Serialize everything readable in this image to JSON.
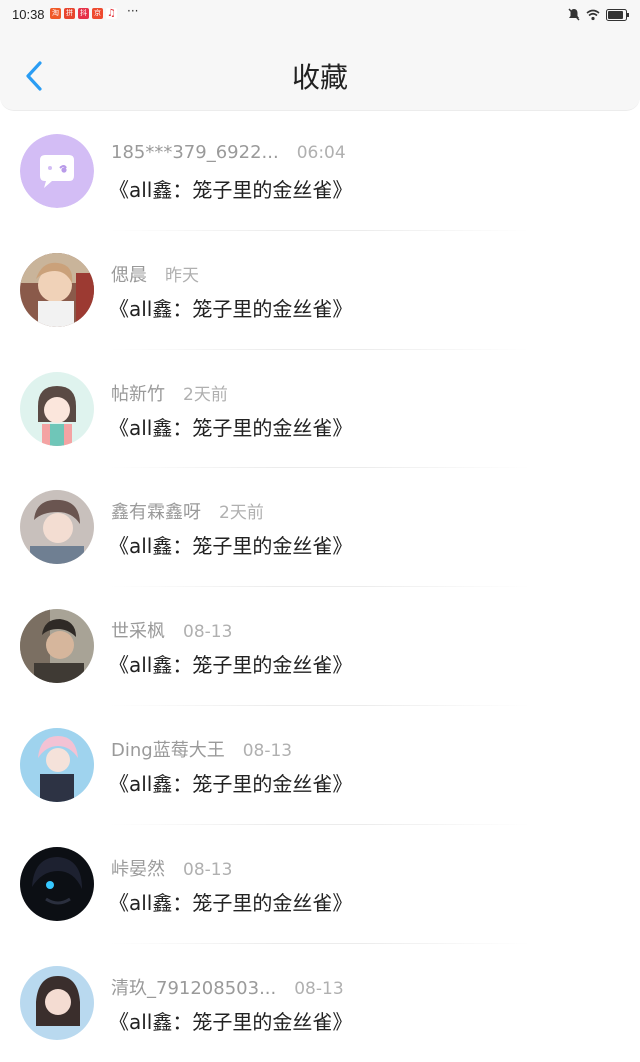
{
  "status_bar": {
    "time": "10:38",
    "dots": "···"
  },
  "header": {
    "title": "收藏"
  },
  "favorites": [
    {
      "username": "185***379_6922...",
      "time": "06:04",
      "book": "《all鑫：笼子里的金丝雀》"
    },
    {
      "username": "偲晨",
      "time": "昨天",
      "book": "《all鑫：笼子里的金丝雀》"
    },
    {
      "username": "帖新竹",
      "time": "2天前",
      "book": "《all鑫：笼子里的金丝雀》"
    },
    {
      "username": "鑫有霖鑫呀",
      "time": "2天前",
      "book": "《all鑫：笼子里的金丝雀》"
    },
    {
      "username": "世采枫",
      "time": "08-13",
      "book": "《all鑫：笼子里的金丝雀》"
    },
    {
      "username": "Ding蓝莓大王",
      "time": "08-13",
      "book": "《all鑫：笼子里的金丝雀》"
    },
    {
      "username": "峠晏然",
      "time": "08-13",
      "book": "《all鑫：笼子里的金丝雀》"
    },
    {
      "username": "清玖_791208503...",
      "time": "08-13",
      "book": "《all鑫：笼子里的金丝雀》"
    }
  ],
  "colors": {
    "accent": "#2a9df4",
    "header_bg": "#f7f7f7"
  }
}
